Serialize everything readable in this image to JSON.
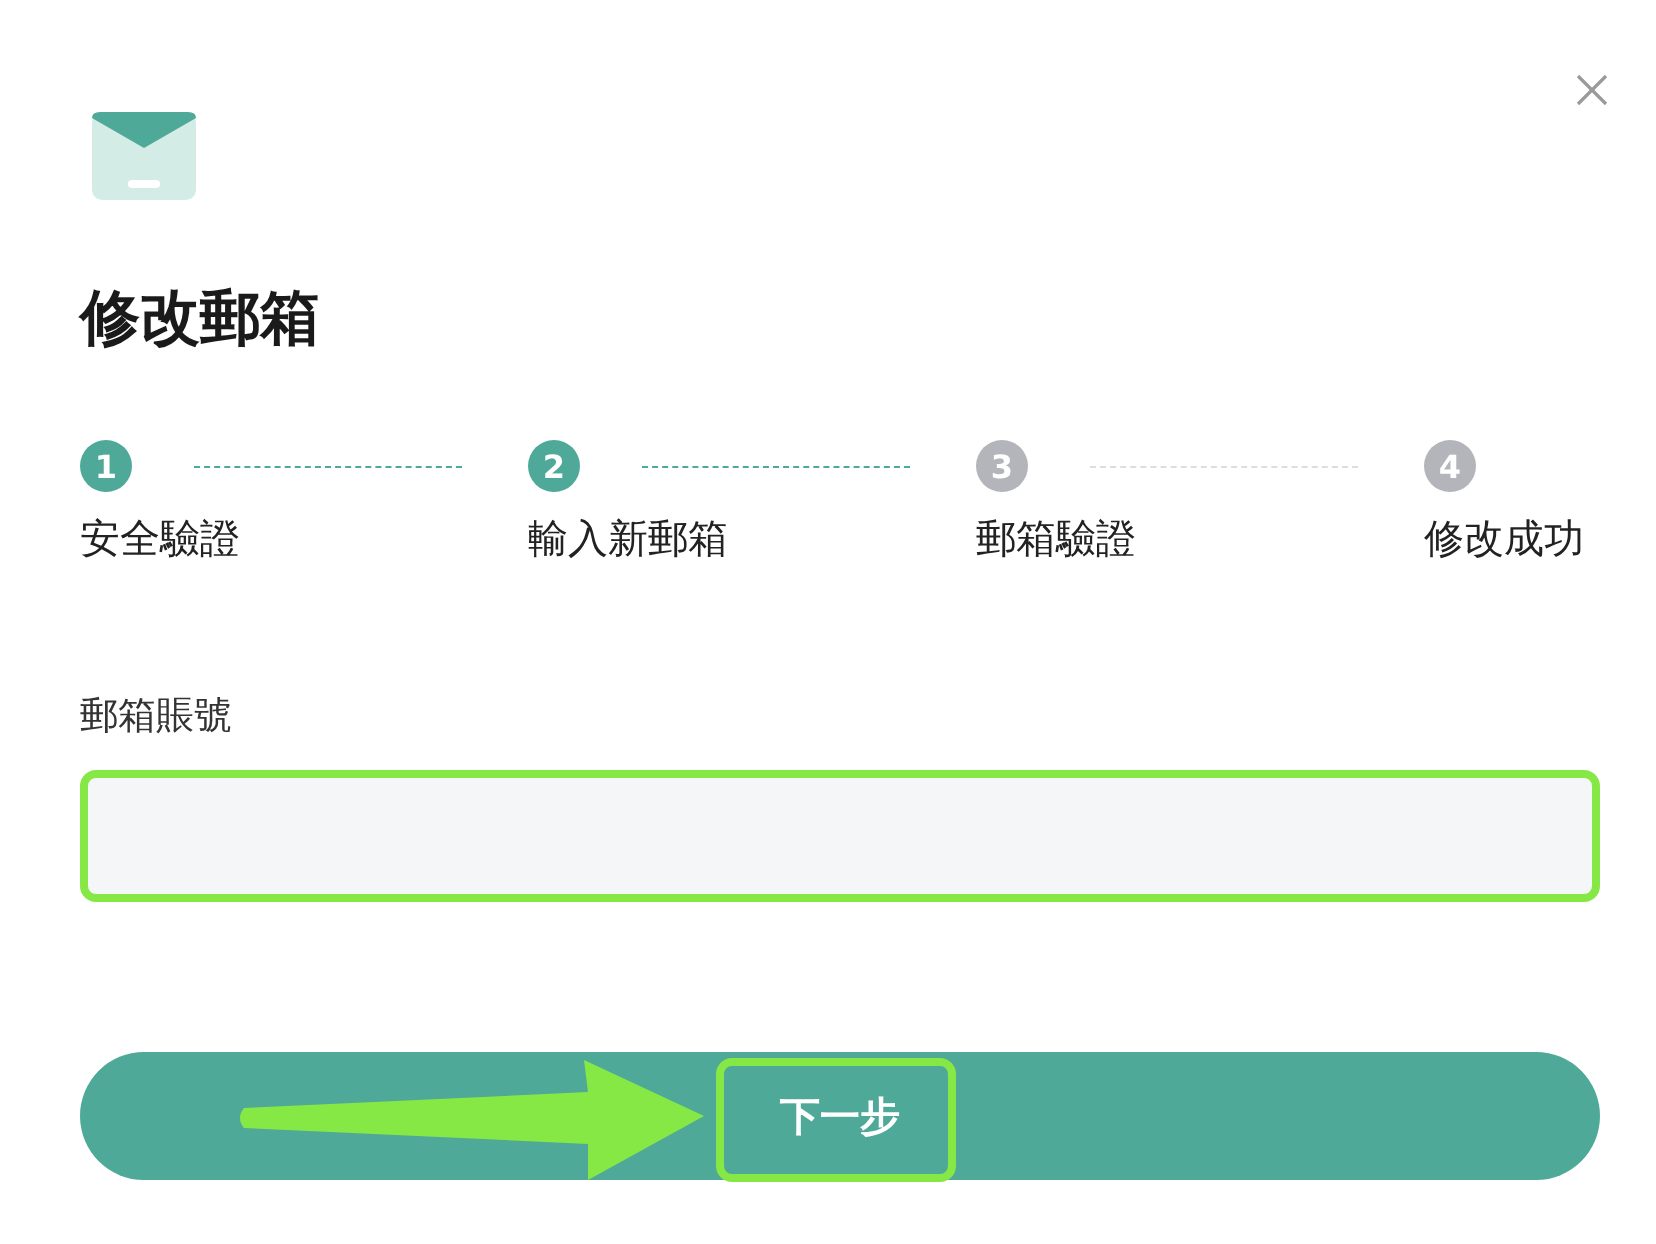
{
  "dialog": {
    "title": "修改郵箱"
  },
  "steps": [
    {
      "number": "1",
      "label": "安全驗證",
      "active": true
    },
    {
      "number": "2",
      "label": "輸入新郵箱",
      "active": true
    },
    {
      "number": "3",
      "label": "郵箱驗證",
      "active": false
    },
    {
      "number": "4",
      "label": "修改成功",
      "active": false
    }
  ],
  "field": {
    "label": "郵箱賬號",
    "highlighted": true
  },
  "next_button": {
    "label": "下一步",
    "highlighted": true,
    "arrow": true
  }
}
